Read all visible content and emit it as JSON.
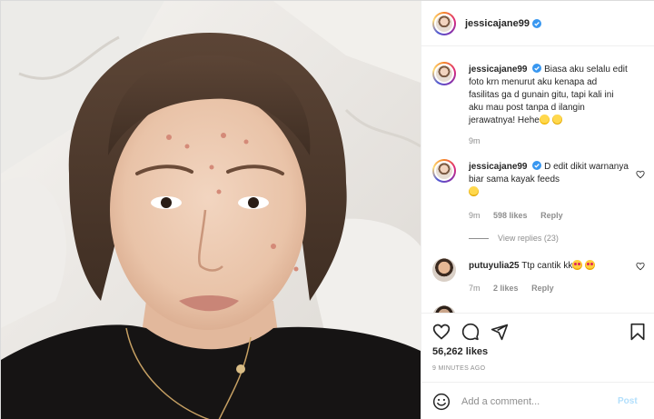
{
  "post": {
    "author": "jessicajane99",
    "verified": true,
    "photo_alt": "jessicajane99",
    "likes": "56,262 likes",
    "posted": "9 MINUTES AGO"
  },
  "comments": [
    {
      "username": "jessicajane99",
      "text": "Biasa aku selalu edit foto krn menurut aku kenapa ad fasilitas ga d gunain gitu, tapi kali ini aku mau post tanpa d ilangin jerawatnya! Hehe",
      "time": "9m",
      "emoji": [
        "yum-emoji",
        "star-emoji"
      ]
    },
    {
      "username": "jessicajane99",
      "text": "D edit dikit warnanya biar sama kayak feeds",
      "time": "9m",
      "likes": "598 likes",
      "reply": "Reply",
      "view_replies": "View replies (23)"
    },
    {
      "username": "putuyulia25",
      "text": "Ttp cantik kk",
      "time": "7m",
      "likes": "2 likes",
      "reply": "Reply"
    }
  ],
  "add_comment": {
    "placeholder": "Add a comment...",
    "post_label": "Post"
  },
  "icons": [
    "heart-icon",
    "comment-icon",
    "share-icon",
    "bookmark-icon",
    "smiley-icon",
    "verified-icon"
  ],
  "colors": {
    "verified": "#3897f0",
    "post_button": "#b2dffc",
    "muted": "#8e8e8e"
  }
}
